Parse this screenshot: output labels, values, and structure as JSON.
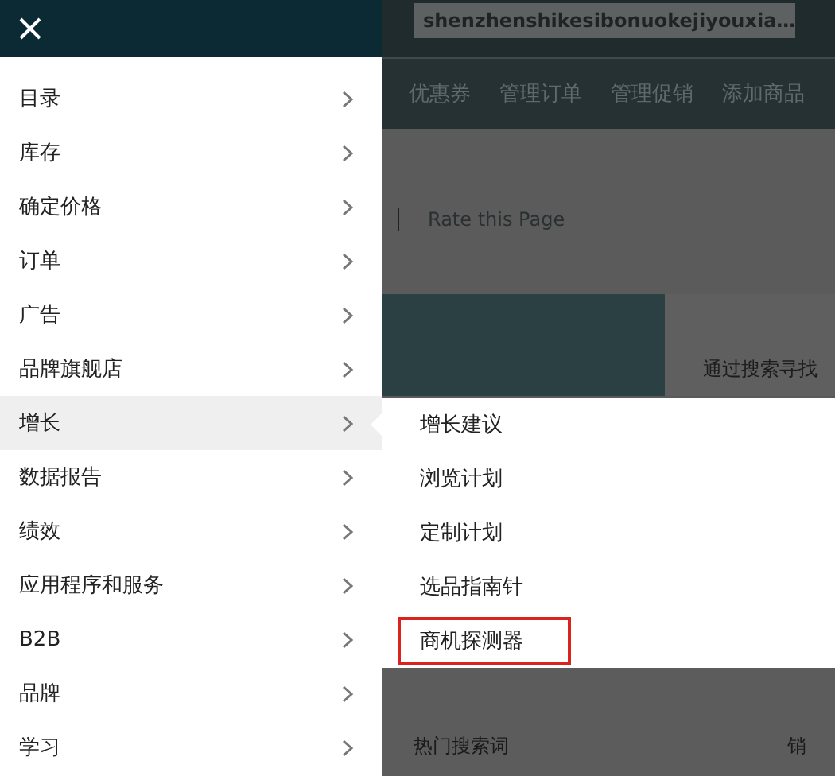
{
  "menu": {
    "items": [
      {
        "label": "目录",
        "selected": false
      },
      {
        "label": "库存",
        "selected": false
      },
      {
        "label": "确定价格",
        "selected": false
      },
      {
        "label": "订单",
        "selected": false
      },
      {
        "label": "广告",
        "selected": false
      },
      {
        "label": "品牌旗舰店",
        "selected": false
      },
      {
        "label": "增长",
        "selected": true
      },
      {
        "label": "数据报告",
        "selected": false
      },
      {
        "label": "绩效",
        "selected": false
      },
      {
        "label": "应用程序和服务",
        "selected": false
      },
      {
        "label": "B2B",
        "selected": false
      },
      {
        "label": "品牌",
        "selected": false
      },
      {
        "label": "学习",
        "selected": false
      }
    ]
  },
  "submenu": {
    "items": [
      {
        "label": "增长建议",
        "highlighted": false
      },
      {
        "label": "浏览计划",
        "highlighted": false
      },
      {
        "label": "定制计划",
        "highlighted": false
      },
      {
        "label": "选品指南针",
        "highlighted": false
      },
      {
        "label": "商机探测器",
        "highlighted": true
      }
    ]
  },
  "page": {
    "store_name": "shenzhenshikesibonuokejiyouxia…",
    "nav": [
      "优惠券",
      "管理订单",
      "管理促销",
      "添加商品"
    ],
    "rate_link": "Rate this Page",
    "banner_text": "通过搜索寻找",
    "table_headers": [
      "热门搜索词",
      "销"
    ]
  }
}
